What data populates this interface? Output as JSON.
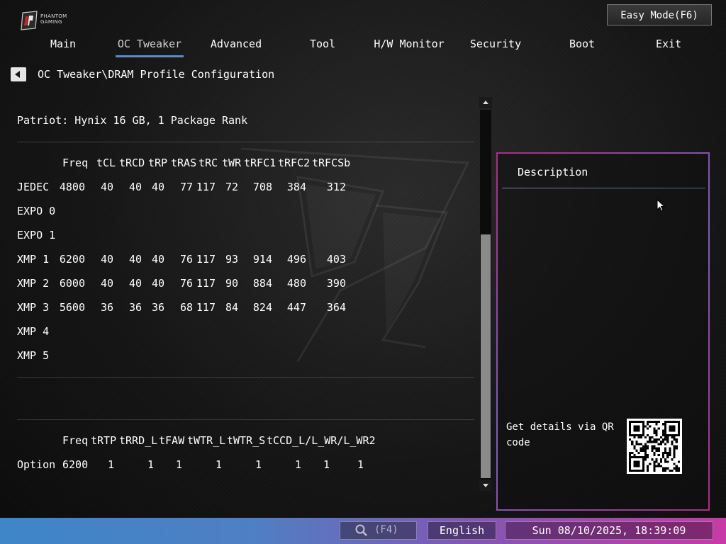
{
  "brand": {
    "logo_text_line1": "PHANTOM",
    "logo_text_line2": "GAMING"
  },
  "header": {
    "easy_mode_label": "Easy Mode(F6)"
  },
  "tabs": [
    {
      "label": "Main",
      "active": false
    },
    {
      "label": "OC Tweaker",
      "active": true
    },
    {
      "label": "Advanced",
      "active": false
    },
    {
      "label": "Tool",
      "active": false
    },
    {
      "label": "H/W Monitor",
      "active": false
    },
    {
      "label": "Security",
      "active": false
    },
    {
      "label": "Boot",
      "active": false
    },
    {
      "label": "Exit",
      "active": false
    }
  ],
  "breadcrumb": "OC Tweaker\\DRAM Profile Configuration",
  "module_info": "Patriot: Hynix 16 GB, 1 Package Rank",
  "profile_table": {
    "headers": [
      "Freq",
      "tCL",
      "tRCD",
      "tRP",
      "tRAS",
      "tRC",
      "tWR",
      "tRFC1",
      "tRFC2",
      "tRFCSb"
    ],
    "rows": [
      {
        "name": "JEDEC",
        "values": [
          "4800",
          "40",
          "40",
          "40",
          "77",
          "117",
          "72",
          "708",
          "384",
          "312"
        ]
      },
      {
        "name": "EXPO 0",
        "values": [
          "",
          "",
          "",
          "",
          "",
          "",
          "",
          "",
          "",
          ""
        ]
      },
      {
        "name": "EXPO 1",
        "values": [
          "",
          "",
          "",
          "",
          "",
          "",
          "",
          "",
          "",
          ""
        ]
      },
      {
        "name": "XMP 1",
        "values": [
          "6200",
          "40",
          "40",
          "40",
          "76",
          "117",
          "93",
          "914",
          "496",
          "403"
        ]
      },
      {
        "name": "XMP 2",
        "values": [
          "6000",
          "40",
          "40",
          "40",
          "76",
          "117",
          "90",
          "884",
          "480",
          "390"
        ]
      },
      {
        "name": "XMP 3",
        "values": [
          "5600",
          "36",
          "36",
          "36",
          "68",
          "117",
          "84",
          "824",
          "447",
          "364"
        ]
      },
      {
        "name": "XMP 4",
        "values": [
          "",
          "",
          "",
          "",
          "",
          "",
          "",
          "",
          "",
          ""
        ]
      },
      {
        "name": "XMP 5",
        "values": [
          "",
          "",
          "",
          "",
          "",
          "",
          "",
          "",
          "",
          ""
        ]
      }
    ]
  },
  "option_table": {
    "headers": [
      "Freq",
      "tRTP",
      "tRRD_L",
      "tFAW",
      "tWTR_L",
      "tWTR_S",
      "tCCD_L/L_WR/L_WR2"
    ],
    "rows": [
      {
        "name": "Option",
        "values": [
          "6200",
          "1",
          "1",
          "1",
          "1",
          "1",
          "1",
          "1",
          "1"
        ]
      }
    ]
  },
  "description": {
    "title": "Description",
    "qr_label": "Get details via QR code"
  },
  "footer": {
    "search_label": "(F4)",
    "language": "English",
    "datetime": "Sun 08/10/2025, 18:39:09"
  },
  "colors": {
    "active_tab_underline": "#5a8ccc",
    "panel_border_pink": "#b02a86",
    "panel_border_purple": "#7a5fc0",
    "bottom_bar_left": "#3d86c8",
    "bottom_bar_right": "#c83aa6"
  }
}
